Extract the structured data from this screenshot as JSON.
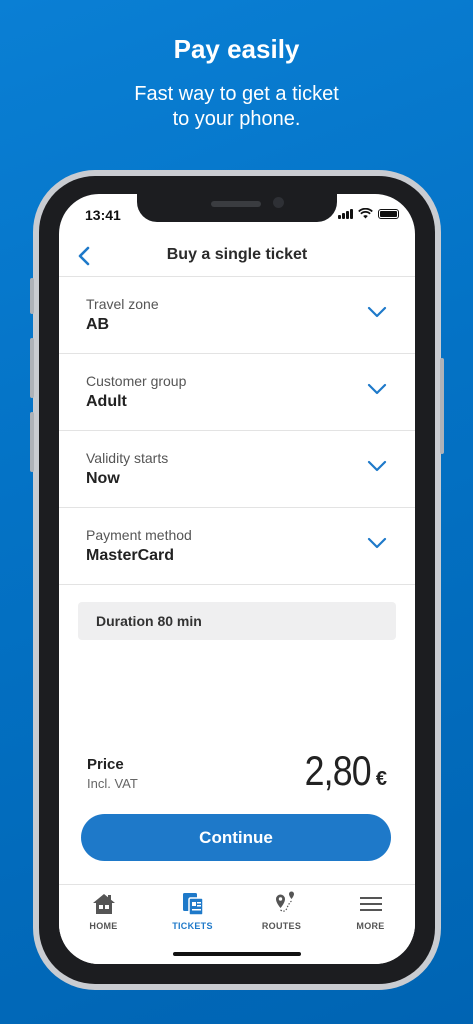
{
  "promo": {
    "headline": "Pay easily",
    "subline_1": "Fast way to get a ticket",
    "subline_2": "to your phone."
  },
  "status_bar": {
    "time": "13:41"
  },
  "header": {
    "title": "Buy a single ticket",
    "back_icon": "chevron-left-icon"
  },
  "rows": [
    {
      "label": "Travel zone",
      "value": "AB"
    },
    {
      "label": "Customer group",
      "value": "Adult"
    },
    {
      "label": "Validity starts",
      "value": "Now"
    },
    {
      "label": "Payment method",
      "value": "MasterCard"
    }
  ],
  "info": {
    "text": "Duration 80 min"
  },
  "price": {
    "label": "Price",
    "vat": "Incl. VAT",
    "amount": "2,80",
    "currency": "€"
  },
  "continue_label": "Continue",
  "tabs": [
    {
      "label": "HOME",
      "icon": "house-icon",
      "active": false
    },
    {
      "label": "TICKETS",
      "icon": "tickets-icon",
      "active": true
    },
    {
      "label": "ROUTES",
      "icon": "route-pin-icon",
      "active": false
    },
    {
      "label": "MORE",
      "icon": "menu-icon",
      "active": false
    }
  ],
  "colors": {
    "background": "#0473c6",
    "accent": "#1e79c9",
    "text": "#222222"
  }
}
